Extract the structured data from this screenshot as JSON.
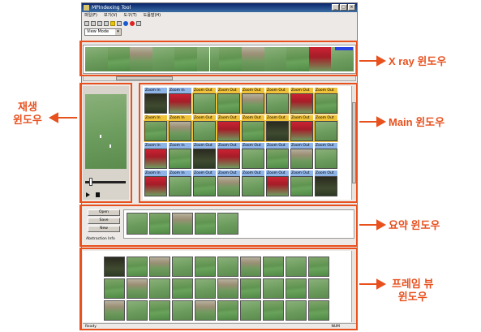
{
  "window": {
    "title": "MPIndexing Tool",
    "menu": [
      "파일(F)",
      "보기(V)",
      "도구(T)",
      "도움말(H)"
    ],
    "view_mode": "View Mode"
  },
  "summary": {
    "buttons": [
      "Open",
      "Save",
      "New"
    ],
    "label": "Abstraction Info"
  },
  "main": {
    "labels": [
      "Zoom In",
      "Zoom In",
      "Zoom Out",
      "Zoom Out",
      "Zoom Out",
      "Zoom Out",
      "Zoom Out",
      "Zoom Out"
    ]
  },
  "statusbar": {
    "left": "Ready",
    "right": "NUM"
  },
  "annotations": {
    "xray": "X ray 윈도우",
    "player": "재생\n윈도우",
    "main": "Main 윈도우",
    "summary": "요약 윈도우",
    "frame_view": "프레임 뷰\n윈도우"
  },
  "colors": {
    "annotation": "#e8501e",
    "label_yellow": "#f0c23a",
    "label_blue": "#8fb4e8"
  }
}
